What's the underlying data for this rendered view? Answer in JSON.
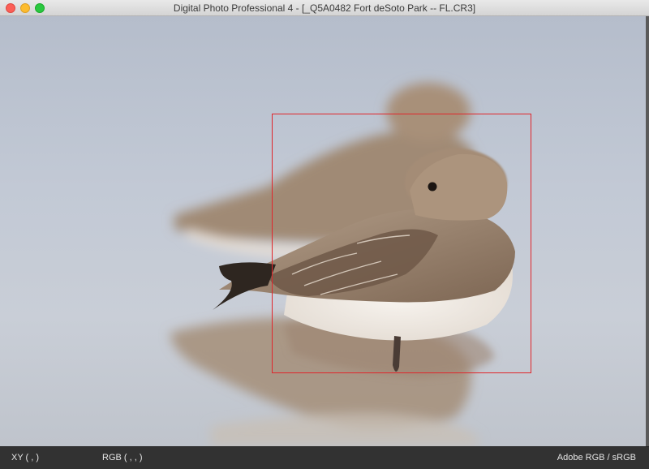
{
  "window": {
    "title": "Digital Photo Professional 4 - [_Q5A0482 Fort deSoto Park -- FL.CR3]"
  },
  "icons": {
    "close": "traffic-light-close-icon",
    "minimize": "traffic-light-minimize-icon",
    "maximize": "traffic-light-maximize-icon"
  },
  "status": {
    "xy": "XY (           ,            )",
    "rgb": "RGB (          ,          ,          )",
    "profile": "Adobe RGB / sRGB"
  },
  "colors": {
    "focus_frame": "#e0262b",
    "status_bg": "#323232"
  }
}
